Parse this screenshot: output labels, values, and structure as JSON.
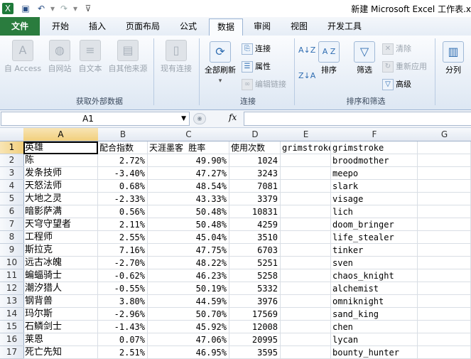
{
  "window": {
    "title": "新建 Microsoft Excel 工作表.x"
  },
  "qat": {
    "icons": [
      "excel-app-icon",
      "save-icon",
      "undo-icon",
      "redo-icon"
    ]
  },
  "tabs": [
    "文件",
    "开始",
    "插入",
    "页面布局",
    "公式",
    "数据",
    "审阅",
    "视图",
    "开发工具"
  ],
  "active_tab": "数据",
  "ribbon": {
    "get_external": {
      "label": "获取外部数据",
      "buttons": [
        "自 Access",
        "自网站",
        "自文本",
        "自其他来源",
        "现有连接"
      ]
    },
    "connections": {
      "label": "连接",
      "refresh_all": "全部刷新",
      "items": [
        "连接",
        "属性",
        "编辑链接"
      ]
    },
    "sort_filter": {
      "label": "排序和筛选",
      "sort": "排序",
      "filter": "筛选",
      "items": [
        "清除",
        "重新应用",
        "高级"
      ],
      "az": "A↓Z",
      "za": "Z↓A"
    },
    "data_tools": {
      "split": "分列"
    }
  },
  "formula_bar": {
    "name_box": "A1",
    "fx": "fx",
    "formula": ""
  },
  "columns": [
    "A",
    "B",
    "C",
    "D",
    "E",
    "F",
    "G"
  ],
  "rows": [
    [
      "英雄",
      "配合指数",
      "天涯墨客 胜率",
      "使用次数",
      "grimstroke",
      "grimstroke",
      ""
    ],
    [
      "陈",
      "2.72%",
      "49.90%",
      "1024",
      "",
      "broodmother",
      ""
    ],
    [
      "发条技师",
      "-3.40%",
      "47.27%",
      "3243",
      "",
      "meepo",
      ""
    ],
    [
      "天怒法师",
      "0.68%",
      "48.54%",
      "7081",
      "",
      "slark",
      ""
    ],
    [
      "大地之灵",
      "-2.33%",
      "43.33%",
      "3379",
      "",
      "visage",
      ""
    ],
    [
      "暗影萨满",
      "0.56%",
      "50.48%",
      "10831",
      "",
      "lich",
      ""
    ],
    [
      "天穹守望者",
      "2.11%",
      "50.48%",
      "4259",
      "",
      "doom_bringer",
      ""
    ],
    [
      "工程师",
      "2.55%",
      "45.04%",
      "3510",
      "",
      "life_stealer",
      ""
    ],
    [
      "斯拉克",
      "7.16%",
      "47.75%",
      "6703",
      "",
      "tinker",
      ""
    ],
    [
      "远古冰魄",
      "-2.70%",
      "48.22%",
      "5251",
      "",
      "sven",
      ""
    ],
    [
      "蝙蝠骑士",
      "-0.62%",
      "46.23%",
      "5258",
      "",
      "chaos_knight",
      ""
    ],
    [
      "潮汐猎人",
      "-0.55%",
      "50.19%",
      "5332",
      "",
      "alchemist",
      ""
    ],
    [
      "钢背兽",
      "3.80%",
      "44.59%",
      "3976",
      "",
      "omniknight",
      ""
    ],
    [
      "玛尔斯",
      "-2.96%",
      "50.70%",
      "17569",
      "",
      "sand_king",
      ""
    ],
    [
      "石鳞剑士",
      "-1.43%",
      "45.92%",
      "12008",
      "",
      "chen",
      ""
    ],
    [
      "莱恩",
      "0.07%",
      "47.06%",
      "20995",
      "",
      "lycan",
      ""
    ],
    [
      "死亡先知",
      "2.51%",
      "46.95%",
      "3595",
      "",
      "bounty_hunter",
      ""
    ]
  ]
}
